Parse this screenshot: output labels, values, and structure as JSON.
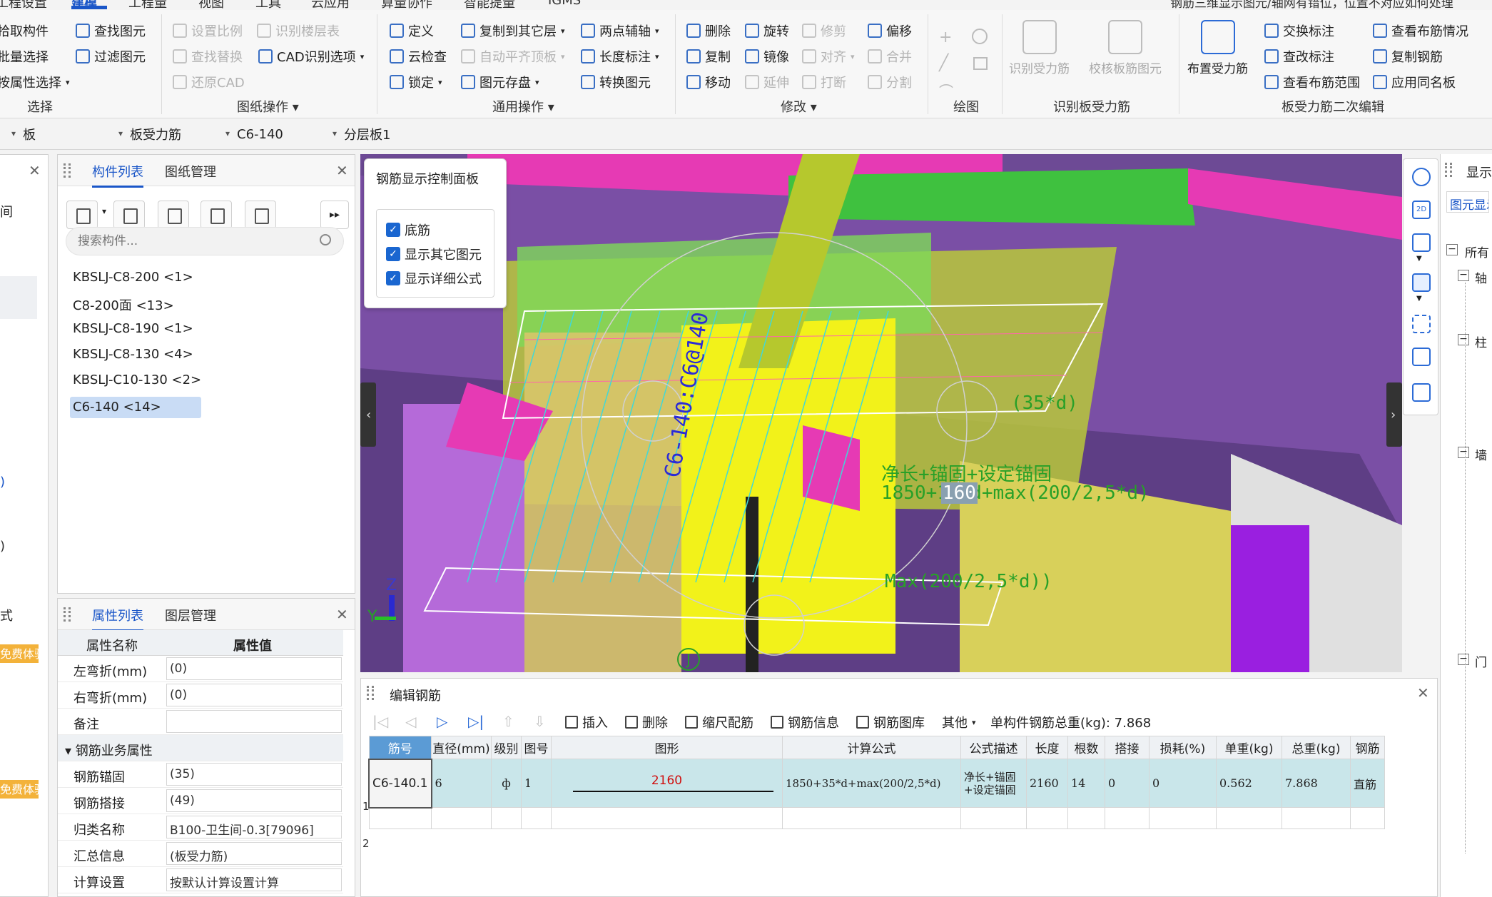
{
  "menu": {
    "items": [
      "工程设置",
      "建模",
      "工程量",
      "视图",
      "工具",
      "云应用",
      "算量协作",
      "智能提量",
      "IGMS"
    ],
    "active_index": 1,
    "notice": "钢筋三维显示图元/轴网有错位，位置不对应如何处理"
  },
  "ribbon": {
    "select": {
      "items": [
        "拾取构件",
        "批量选择",
        "按属性选择"
      ],
      "label": "选择"
    },
    "find": {
      "items": [
        "查找图元",
        "过滤图元"
      ]
    },
    "drawing": {
      "items": [
        "设置比例",
        "查找替换",
        "还原CAD",
        "识别楼层表",
        "CAD识别选项"
      ],
      "label": "图纸操作"
    },
    "general": {
      "items": [
        "定义",
        "云检查",
        "锁定",
        "复制到其它层",
        "自动平齐顶板",
        "图元存盘",
        "两点辅轴",
        "长度标注",
        "转换图元"
      ],
      "label": "通用操作"
    },
    "modify": {
      "items": [
        "删除",
        "复制",
        "移动",
        "旋转",
        "镜像",
        "延伸",
        "修剪",
        "对齐",
        "打断",
        "偏移",
        "合并",
        "分割"
      ],
      "label": "修改"
    },
    "draw": {
      "label": "绘图"
    },
    "identify": {
      "items": [
        "识别受力筋",
        "校核板筋图元"
      ],
      "label": "识别板受力筋"
    },
    "edit2": {
      "big": "布置受力筋",
      "items": [
        "交换标注",
        "查改标注",
        "查看布筋范围",
        "查看布筋情况",
        "复制钢筋",
        "应用同名板"
      ],
      "label": "板受力筋二次编辑"
    }
  },
  "selectors": {
    "s1": "板",
    "s2": "板受力筋",
    "s3": "C6-140",
    "s4": "分层板1"
  },
  "component_panel": {
    "tabs": [
      "构件列表",
      "图纸管理"
    ],
    "search_placeholder": "搜索构件...",
    "items": [
      "KBSLJ-C8-200 <1>",
      "C8-200面 <13>",
      "KBSLJ-C8-190 <1>",
      "KBSLJ-C8-130 <4>",
      "KBSLJ-C10-130 <2>",
      "C6-140 <14>"
    ],
    "selected_index": 5
  },
  "property_panel": {
    "tabs": [
      "属性列表",
      "图层管理"
    ],
    "headers": [
      "属性名称",
      "属性值"
    ],
    "rows": [
      {
        "name": "左弯折(mm)",
        "value": "(0)"
      },
      {
        "name": "右弯折(mm)",
        "value": "(0)"
      },
      {
        "name": "备注",
        "value": ""
      }
    ],
    "group": "钢筋业务属性",
    "group_rows": [
      {
        "name": "钢筋锚固",
        "value": "(35)"
      },
      {
        "name": "钢筋搭接",
        "value": "(49)"
      },
      {
        "name": "归类名称",
        "value": "B100-卫生间-0.3[79096]"
      },
      {
        "name": "汇总信息",
        "value": "(板受力筋)"
      },
      {
        "name": "计算设置",
        "value": "按默认计算设置计算"
      }
    ]
  },
  "left_strip": {
    "tags": [
      "免费体验",
      "免费体验"
    ],
    "labels": [
      "间",
      ")",
      ")",
      "式"
    ]
  },
  "control_panel": {
    "title": "钢筋显示控制面板",
    "options": [
      "底筋",
      "显示其它图元",
      "显示详细公式"
    ]
  },
  "viewport": {
    "annotations": {
      "label_vertical": "C6-140:C6@140",
      "anchor": "(35*d)",
      "formula_desc": "净长+锚固+设定锚固",
      "formula": "1850+160d+max(200/2,5*d)",
      "max_expr": "Max(200/2,5*d))",
      "dim": "160"
    },
    "axis": {
      "z": "Z",
      "y": "Y"
    },
    "marker": "J"
  },
  "right_panel": {
    "title": "显示",
    "tab": "图元显示",
    "tree": [
      "所有",
      "轴",
      "柱",
      "墙",
      "门"
    ]
  },
  "edit_rebar": {
    "title": "编辑钢筋",
    "tools": [
      "插入",
      "删除",
      "缩尺配筋",
      "钢筋信息",
      "钢筋图库",
      "其他"
    ],
    "total_label": "单构件钢筋总重(kg): 7.868",
    "headers": [
      "筋号",
      "直径(mm)",
      "级别",
      "图号",
      "图形",
      "计算公式",
      "公式描述",
      "长度",
      "根数",
      "搭接",
      "损耗(%)",
      "单重(kg)",
      "总重(kg)",
      "钢筋"
    ],
    "rows": [
      {
        "num": "1",
        "id": "C6-140.1",
        "dia": "6",
        "grade": "ф",
        "fig": "1",
        "shape_len": "2160",
        "formula": "1850+35*d+max(200/2,5*d)",
        "desc": "净长+锚固+设定锚固",
        "len": "2160",
        "count": "14",
        "lap": "0",
        "loss": "0",
        "unit_w": "0.562",
        "total_w": "7.868",
        "type": "直筋"
      }
    ],
    "row2_num": "2"
  }
}
